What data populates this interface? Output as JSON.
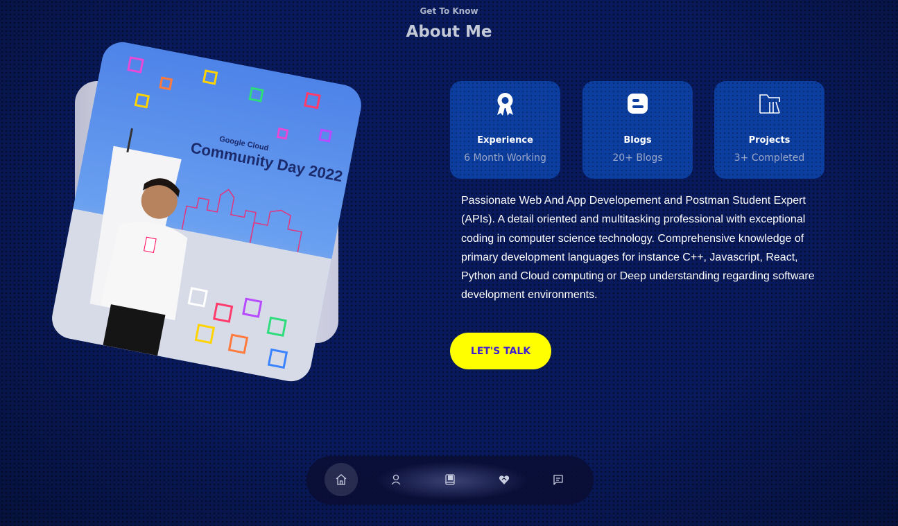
{
  "header": {
    "eyebrow": "Get To Know",
    "title": "About Me"
  },
  "photo": {
    "banner_brand": "Google Cloud",
    "banner_title": "Community Day 2022"
  },
  "cards": [
    {
      "icon": "award-icon",
      "title": "Experience",
      "subtitle": "6 Month Working"
    },
    {
      "icon": "blogger-icon",
      "title": "Blogs",
      "subtitle": "20+ Blogs"
    },
    {
      "icon": "projects-folder-icon",
      "title": "Projects",
      "subtitle": "3+ Completed"
    }
  ],
  "about_text": "Passionate Web And App Developement and Postman Student Expert (APIs). A detail oriented and multitasking professional with exceptional coding in computer science technology. Comprehensive knowledge of primary development languages for instance C++, Javascript, React, Python and Cloud computing or Deep understanding regarding software development environments.",
  "cta_label": "LET'S TALK",
  "nav": {
    "items": [
      {
        "icon": "home-icon",
        "active": true
      },
      {
        "icon": "user-icon",
        "active": false
      },
      {
        "icon": "book-icon",
        "active": false
      },
      {
        "icon": "heart-handshake-icon",
        "active": false
      },
      {
        "icon": "message-icon",
        "active": false
      }
    ]
  },
  "colors": {
    "background": "#091a5c",
    "card": "#0c3ea0",
    "cta": "#ffff00",
    "cta_text": "#3d1fd0"
  }
}
